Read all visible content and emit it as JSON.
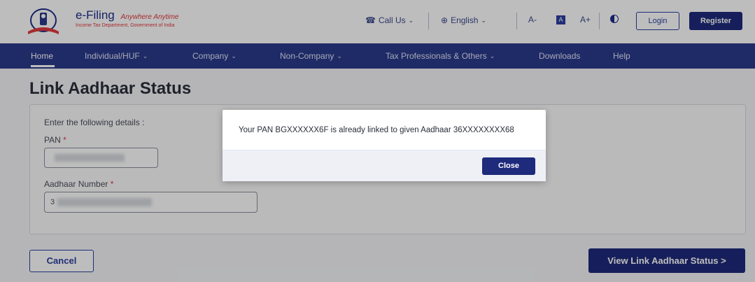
{
  "header": {
    "logo_title": "e-Filing",
    "logo_tagline": "Anywhere Anytime",
    "logo_subtitle": "Income Tax Department, Government of India",
    "call_us": "Call Us",
    "language": "English",
    "font_decrease": "A-",
    "font_default": "A",
    "font_increase": "A+",
    "login": "Login",
    "register": "Register"
  },
  "nav": {
    "items": [
      {
        "label": "Home"
      },
      {
        "label": "Individual/HUF"
      },
      {
        "label": "Company"
      },
      {
        "label": "Non-Company"
      },
      {
        "label": "Tax Professionals & Others"
      },
      {
        "label": "Downloads"
      },
      {
        "label": "Help"
      }
    ]
  },
  "page": {
    "title": "Link Aadhaar Status",
    "instructions": "Enter the following details :",
    "pan_label": "PAN",
    "aadhaar_label": "Aadhaar Number",
    "aadhaar_value_prefix": "3",
    "required_mark": "*",
    "cancel": "Cancel",
    "view_status": "View Link Aadhaar Status >"
  },
  "modal": {
    "message": "Your PAN BGXXXXXX6F is already linked to given Aadhaar 36XXXXXXXX68",
    "close": "Close"
  },
  "colors": {
    "brand_navy": "#1e2a7b",
    "nav_blue": "#2a3a8c",
    "accent_red": "#e0393e"
  }
}
